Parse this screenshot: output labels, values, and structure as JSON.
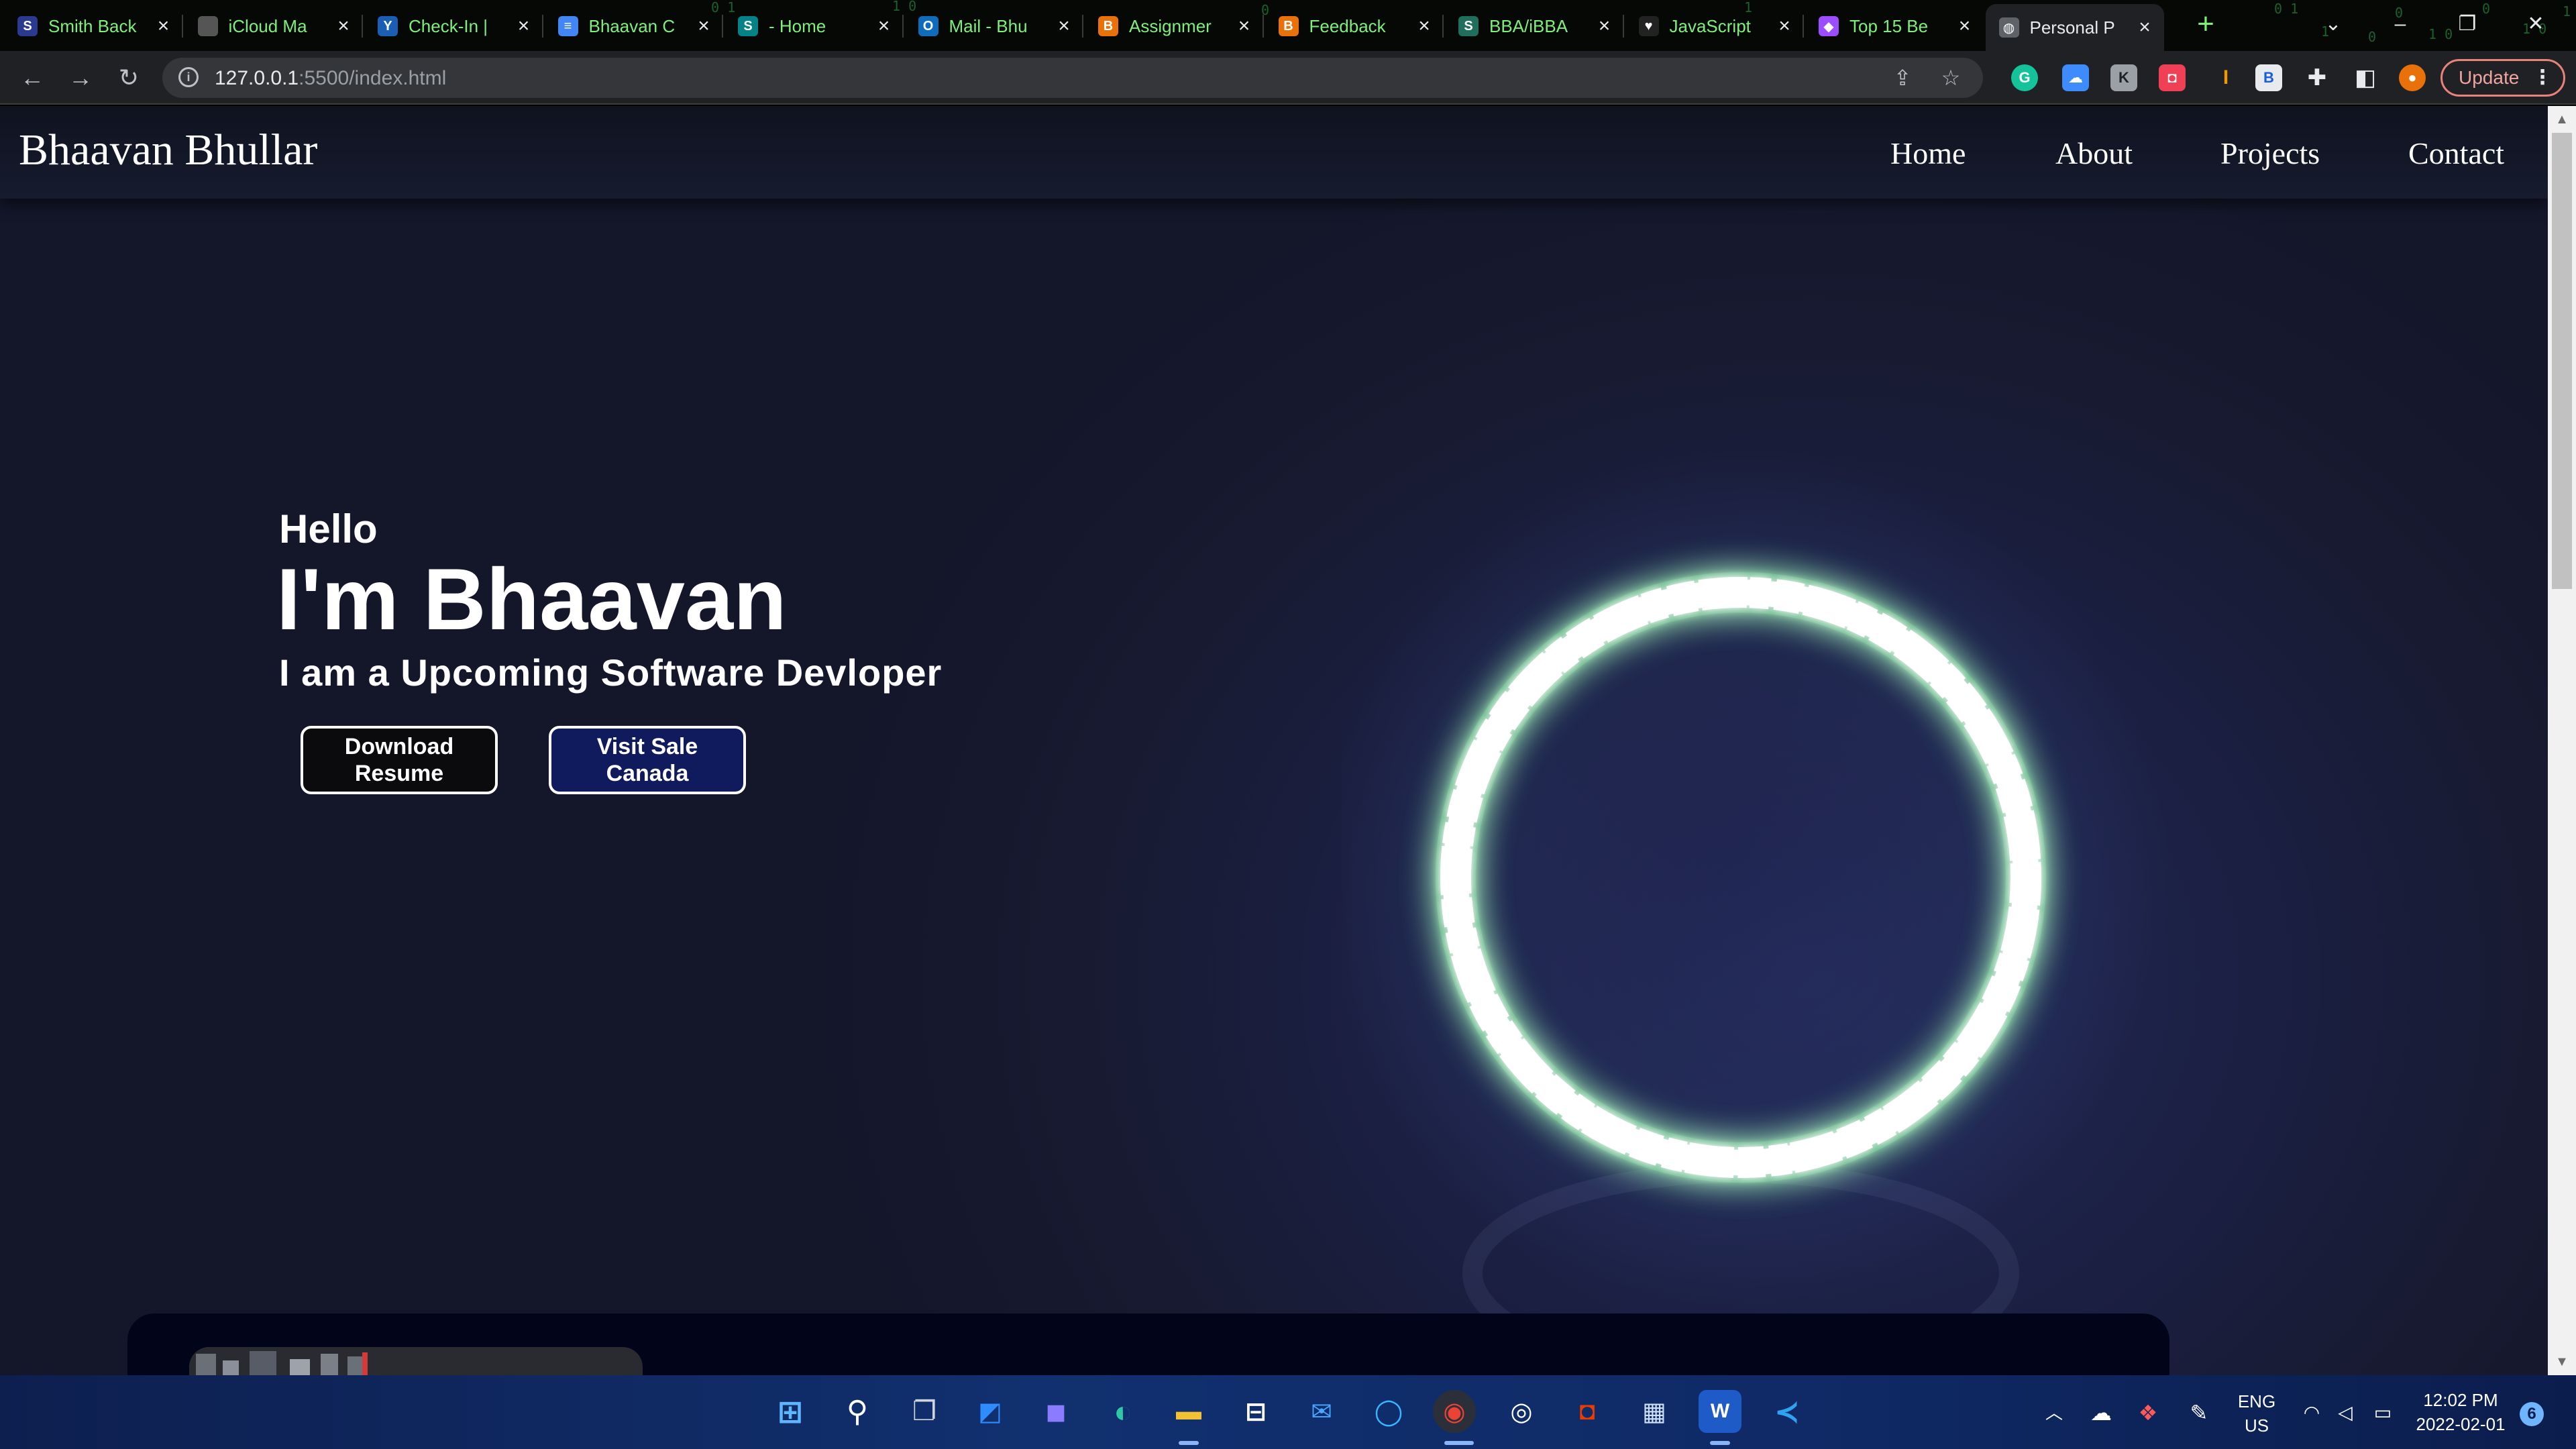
{
  "browser": {
    "tabs": [
      {
        "label": "Smith Back",
        "favicon": "S",
        "favicon_color": "#2b3a8f"
      },
      {
        "label": "iCloud Ma",
        "favicon": "",
        "favicon_color": "#555555"
      },
      {
        "label": "Check-In |",
        "favicon": "Y",
        "favicon_color": "#1a5fb4"
      },
      {
        "label": "Bhaavan C",
        "favicon": "≡",
        "favicon_color": "#4285f4"
      },
      {
        "label": "- Home",
        "favicon": "S",
        "favicon_color": "#038387"
      },
      {
        "label": "Mail - Bhu",
        "favicon": "O",
        "favicon_color": "#0f6cbd"
      },
      {
        "label": "Assignmer",
        "favicon": "B",
        "favicon_color": "#e8710a"
      },
      {
        "label": "Feedback",
        "favicon": "B",
        "favicon_color": "#e8710a"
      },
      {
        "label": "BBA/iBBA",
        "favicon": "S",
        "favicon_color": "#1f6f5c"
      },
      {
        "label": "JavaScript",
        "favicon": "♥",
        "favicon_color": "#222222"
      },
      {
        "label": "Top 15 Be",
        "favicon": "◆",
        "favicon_color": "#9b4dff"
      },
      {
        "label": "Personal P",
        "favicon": "◍",
        "favicon_color": "#5f6368"
      }
    ],
    "active_tab_index": 11,
    "new_tab_label": "+",
    "address": {
      "host": "127.0.0.1",
      "path": ":5500/index.html"
    },
    "update_label": "Update"
  },
  "site": {
    "brand": "Bhaavan Bhullar",
    "nav": [
      "Home",
      "About",
      "Projects",
      "Contact"
    ],
    "hero": {
      "hello": "Hello",
      "name": "I'm Bhaavan",
      "subtitle": "I am a Upcoming Software Devloper",
      "buttons": [
        {
          "label": "Download Resume"
        },
        {
          "label": "Visit Sale Canada"
        }
      ]
    }
  },
  "taskbar": {
    "language": "ENG",
    "region": "US",
    "time": "12:02 PM",
    "date": "2022-02-01",
    "notification_count": "6"
  },
  "colors": {
    "matrix_green": "#7ef07a",
    "page_background": "#1b1f42",
    "ring_glow": "#3cff6a",
    "visit_button": "#101b5e",
    "taskbar": "#11306f"
  },
  "icons": {
    "nav": [
      "back-arrow-icon",
      "forward-arrow-icon",
      "reload-icon"
    ],
    "omnibox": [
      "site-info-icon",
      "share-icon",
      "bookmark-star-icon"
    ],
    "extensions": [
      "grammarly-icon",
      "icloud-icon",
      "extension-icon",
      "pocket-icon",
      "cursor-icon",
      "bitwarden-icon",
      "puzzle-icon",
      "sidepanel-icon",
      "profile-avatar-icon"
    ],
    "taskbar": [
      "windows-start-icon",
      "search-icon",
      "task-view-icon",
      "widgets-icon",
      "teams-chat-icon",
      "edge-icon",
      "file-explorer-icon",
      "store-icon",
      "mail-icon",
      "cortana-icon",
      "chrome-icon",
      "github-icon",
      "office-icon",
      "calendar-app-icon",
      "word-icon",
      "vscode-icon"
    ],
    "tray": [
      "chevron-up-icon",
      "onedrive-icon",
      "dropbox-icon",
      "pen-icon",
      "wifi-icon",
      "volume-icon",
      "battery-icon"
    ]
  }
}
